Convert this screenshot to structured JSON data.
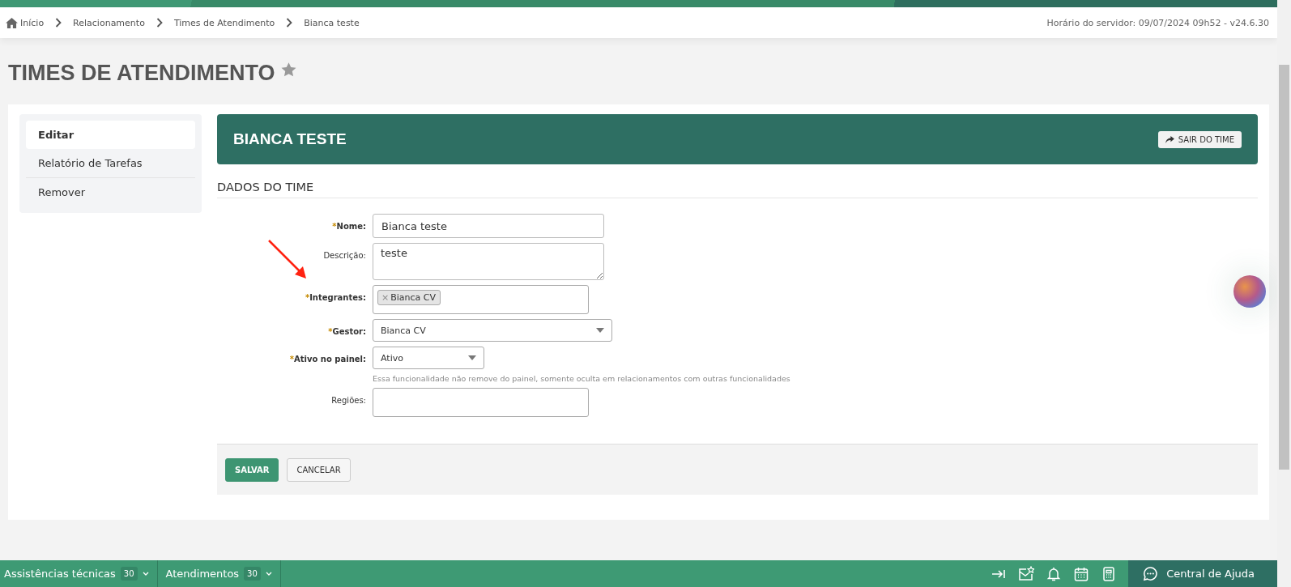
{
  "breadcrumb": [
    {
      "label": "Início",
      "kind": "home"
    },
    {
      "label": "Relacionamento",
      "kind": "link"
    },
    {
      "label": "Times de Atendimento",
      "kind": "link"
    },
    {
      "label": "Bianca teste",
      "kind": "current"
    }
  ],
  "server_info": "Horário do servidor: 09/07/2024 09h52 - v24.6.30",
  "page_title": "TIMES DE ATENDIMENTO",
  "sidebar": {
    "items": [
      {
        "label": "Editar",
        "selected": true
      },
      {
        "label": "Relatório de Tarefas",
        "selected": false
      },
      {
        "label": "Remover",
        "selected": false
      }
    ]
  },
  "team_header": {
    "title": "BIANCA TESTE",
    "button": "SAIR DO TIME"
  },
  "section_title": "DADOS DO TIME",
  "form": {
    "fields": [
      {
        "kind": "text",
        "label": "Nome:",
        "required": true,
        "required_mark": "*",
        "value": "Bianca teste"
      },
      {
        "kind": "textarea",
        "label": "Descrição:",
        "required": false,
        "value": "teste"
      },
      {
        "kind": "tags",
        "label": "Integrantes:",
        "required": true,
        "required_mark": "*",
        "tags": [
          {
            "remove": "×",
            "label": "Bianca CV"
          }
        ]
      },
      {
        "kind": "select",
        "label": "Gestor:",
        "required": true,
        "required_mark": "*",
        "value": "Bianca CV"
      },
      {
        "kind": "compact_select",
        "label": "Ativo no painel:",
        "required": true,
        "required_mark": "*",
        "value": "Ativo",
        "hint": "Essa funcionalidade não remove do painel, somente oculta em relacionamentos com outras funcionalidades"
      },
      {
        "kind": "tags",
        "label": "Regiões:",
        "required": false
      }
    ]
  },
  "buttons": [
    {
      "label": "SALVAR",
      "kind": "primary"
    },
    {
      "label": "CANCELAR",
      "kind": "secondary"
    }
  ],
  "bottom_bar": {
    "tabs": [
      {
        "label": "Assistências técnicas",
        "count": "30"
      },
      {
        "label": "Atendimentos",
        "count": "30"
      }
    ],
    "help": "Central de Ajuda"
  }
}
